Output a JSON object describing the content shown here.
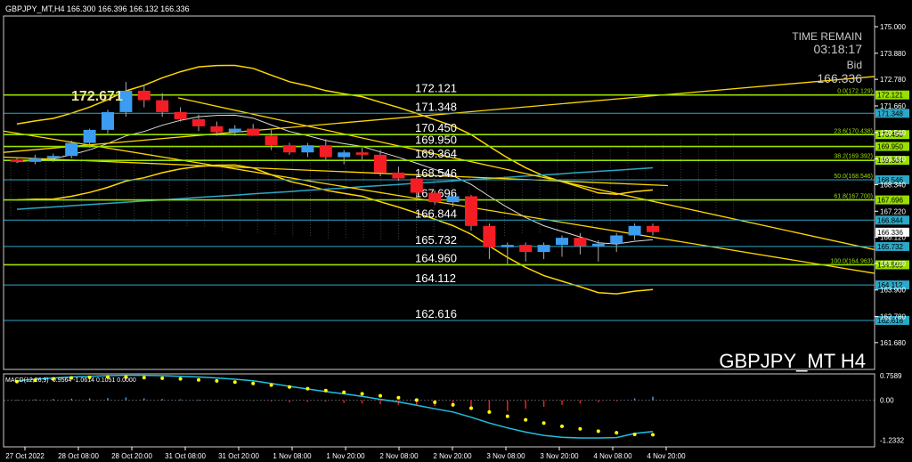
{
  "colors": {
    "background": "#000000",
    "axis": "#ffffff",
    "grid": "#333333",
    "bull": "#3b9cf2",
    "bear": "#f51d24",
    "yellow": "#ffd700",
    "green": "#99e000",
    "cyan": "#2aa8c7",
    "white": "#ffffff",
    "macd_line": "#20c0e0",
    "macd_signal": "#ffff00"
  },
  "header": {
    "info": "GBPJPY_MT,H4  166.300 166.396 166.132 166.336"
  },
  "overlay": {
    "time_remain_label": "TIME REMAIN",
    "time_remain_value": "03:18:17",
    "bid_label": "Bid",
    "bid_value": "166.336",
    "symbol_title": "GBPJPY_MT  H4",
    "high_marker": "172.671"
  },
  "chart_data": [
    {
      "type": "candlestick",
      "title": "GBPJPY_MT  H4",
      "ylim": [
        161.3,
        175.3
      ],
      "y_ticks": [
        "175.000",
        "173.880",
        "172.780",
        "171.660",
        "170.540",
        "169.430",
        "168.340",
        "167.220",
        "166.120",
        "165.020",
        "163.900",
        "162.780",
        "161.680"
      ],
      "x_ticks": [
        "27 Oct 2022",
        "28 Oct 08:00",
        "28 Oct 20:00",
        "31 Oct 08:00",
        "31 Oct 20:00",
        "1 Nov 08:00",
        "1 Nov 20:00",
        "2 Nov 08:00",
        "2 Nov 20:00",
        "3 Nov 08:00",
        "3 Nov 20:00",
        "4 Nov 08:00",
        "4 Nov 20:00"
      ],
      "candles": [
        [
          169.4,
          169.45,
          169.25,
          169.3
        ],
        [
          169.3,
          169.6,
          169.2,
          169.45
        ],
        [
          169.45,
          169.65,
          169.3,
          169.55
        ],
        [
          169.55,
          170.2,
          169.45,
          170.1
        ],
        [
          170.1,
          170.7,
          169.9,
          170.65
        ],
        [
          170.65,
          171.5,
          170.5,
          171.4
        ],
        [
          171.4,
          172.67,
          171.2,
          172.3
        ],
        [
          172.3,
          172.55,
          171.6,
          171.9
        ],
        [
          171.9,
          172.2,
          171.2,
          171.4
        ],
        [
          171.4,
          171.6,
          171.0,
          171.1
        ],
        [
          171.1,
          171.3,
          170.6,
          170.8
        ],
        [
          170.8,
          171.0,
          170.4,
          170.55
        ],
        [
          170.55,
          170.85,
          170.4,
          170.7
        ],
        [
          170.7,
          170.9,
          170.5,
          170.4
        ],
        [
          170.4,
          170.65,
          169.8,
          170.0
        ],
        [
          170.0,
          170.1,
          169.6,
          169.7
        ],
        [
          169.7,
          170.1,
          169.5,
          170.0
        ],
        [
          170.0,
          170.25,
          169.4,
          169.5
        ],
        [
          169.5,
          169.8,
          169.2,
          169.7
        ],
        [
          169.7,
          169.9,
          169.4,
          169.6
        ],
        [
          169.6,
          169.8,
          168.7,
          168.85
        ],
        [
          168.85,
          169.1,
          168.5,
          168.6
        ],
        [
          168.6,
          168.8,
          167.8,
          168.0
        ],
        [
          168.0,
          168.1,
          167.5,
          167.6
        ],
        [
          167.6,
          167.95,
          167.4,
          167.85
        ],
        [
          167.85,
          167.9,
          166.4,
          166.6
        ],
        [
          166.6,
          166.7,
          165.2,
          165.7
        ],
        [
          165.7,
          165.9,
          165.0,
          165.8
        ],
        [
          165.8,
          165.9,
          165.1,
          165.5
        ],
        [
          165.5,
          165.9,
          165.2,
          165.8
        ],
        [
          165.8,
          166.2,
          165.3,
          166.1
        ],
        [
          166.1,
          166.3,
          165.4,
          165.75
        ],
        [
          165.75,
          166.0,
          165.1,
          165.85
        ],
        [
          165.85,
          166.3,
          165.5,
          166.2
        ],
        [
          166.2,
          166.7,
          166.0,
          166.6
        ],
        [
          166.6,
          166.7,
          166.2,
          166.34
        ]
      ],
      "levels": [
        {
          "value": 172.121,
          "label": "172.121",
          "kind": "green"
        },
        {
          "value": 171.348,
          "label": "171.348",
          "kind": "cyan"
        },
        {
          "value": 170.45,
          "label": "170.450",
          "kind": "green"
        },
        {
          "value": 169.95,
          "label": "169.950",
          "kind": "green"
        },
        {
          "value": 169.364,
          "label": "169.364",
          "kind": "green"
        },
        {
          "value": 168.546,
          "label": "168.546",
          "kind": "cyan"
        },
        {
          "value": 167.696,
          "label": "167.696",
          "kind": "green"
        },
        {
          "value": 166.844,
          "label": "166.844",
          "kind": "cyan"
        },
        {
          "value": 165.732,
          "label": "165.732",
          "kind": "cyan"
        },
        {
          "value": 164.96,
          "label": "164.960",
          "kind": "green"
        },
        {
          "value": 164.112,
          "label": "164.112",
          "kind": "cyan"
        },
        {
          "value": 162.616,
          "label": "162.616",
          "kind": "cyan"
        }
      ],
      "fibonacci": [
        {
          "value": 172.129,
          "label": "0.0(172.129)"
        },
        {
          "value": 170.438,
          "label": "23.6(170.438)"
        },
        {
          "value": 169.392,
          "label": "38.2(169.392)"
        },
        {
          "value": 168.546,
          "label": "50.0(168.546)"
        },
        {
          "value": 167.7,
          "label": "61.8(167.700)"
        },
        {
          "value": 164.963,
          "label": "100.0(164.963)"
        }
      ],
      "current_price": {
        "value": 166.336,
        "label": "166.336"
      }
    },
    {
      "type": "macd",
      "title": "MACD(12,26,9) -0.9564 -1.0614 0.1051 0.0000",
      "ylim": [
        -1.38,
        0.87
      ],
      "y_ticks": [
        "0.7589",
        "0.00",
        "-1.2332"
      ],
      "histogram": [
        0.02,
        0.03,
        0.04,
        0.05,
        0.06,
        0.07,
        0.09,
        0.06,
        0.04,
        0.03,
        0.02,
        0.01,
        0.0,
        -0.02,
        -0.04,
        -0.06,
        -0.05,
        -0.04,
        -0.08,
        -0.1,
        -0.12,
        -0.14,
        -0.16,
        -0.18,
        -0.2,
        -0.3,
        -0.38,
        -0.33,
        -0.26,
        -0.2,
        -0.14,
        -0.1,
        -0.06,
        -0.03,
        0.06,
        0.11
      ],
      "macd": [
        0.6,
        0.65,
        0.69,
        0.72,
        0.74,
        0.76,
        0.77,
        0.77,
        0.76,
        0.74,
        0.72,
        0.69,
        0.65,
        0.6,
        0.52,
        0.43,
        0.35,
        0.27,
        0.2,
        0.12,
        0.03,
        -0.05,
        -0.15,
        -0.26,
        -0.36,
        -0.52,
        -0.7,
        -0.85,
        -0.98,
        -1.08,
        -1.14,
        -1.16,
        -1.16,
        -1.15,
        -1.02,
        -0.96
      ],
      "signal": [
        0.58,
        0.62,
        0.66,
        0.69,
        0.71,
        0.72,
        0.72,
        0.7,
        0.68,
        0.66,
        0.63,
        0.6,
        0.56,
        0.52,
        0.47,
        0.41,
        0.36,
        0.3,
        0.25,
        0.2,
        0.14,
        0.08,
        0.01,
        -0.06,
        -0.14,
        -0.24,
        -0.36,
        -0.49,
        -0.6,
        -0.7,
        -0.8,
        -0.88,
        -0.95,
        -1.0,
        -1.05,
        -1.06
      ]
    }
  ]
}
